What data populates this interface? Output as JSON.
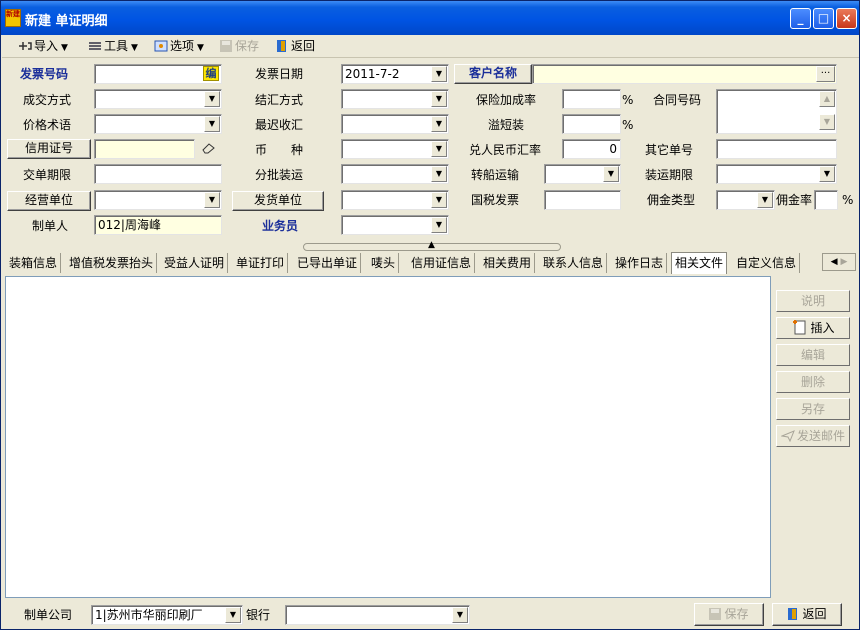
{
  "window": {
    "title": "新建 单证明细",
    "app_icon_text": "新建"
  },
  "title_buttons": {
    "minimize": "_",
    "maximize": "□",
    "close": "×"
  },
  "toolbar": {
    "import": "导入",
    "tools": "工具",
    "options": "选项",
    "save": "保存",
    "back": "返回"
  },
  "form": {
    "invoice_no_label": "发票号码",
    "invoice_no_badge": "编",
    "invoice_date_label": "发票日期",
    "invoice_date_value": "2011-7-2",
    "customer_name_button": "客户名称",
    "customer_name_ellipsis": "···",
    "deal_method_label": "成交方式",
    "settlement_method_label": "结汇方式",
    "insurance_markup_label": "保险加成率",
    "insurance_markup_unit": "%",
    "contract_no_label": "合同号码",
    "price_term_label": "价格术语",
    "latest_collection_label": "最迟收汇",
    "overage_label": "溢短装",
    "overage_unit": "%",
    "lc_no_button": "信用证号",
    "currency_label_1": "币",
    "currency_label_2": "种",
    "rmb_rate_label": "兑人民币汇率",
    "rmb_rate_value": "0",
    "other_doc_no_label": "其它单号",
    "delivery_period_label": "交单期限",
    "partial_shipment_label": "分批装运",
    "transshipment_label": "转船运输",
    "shipment_period_label": "装运期限",
    "business_unit_button": "经营单位",
    "shipper_button": "发货单位",
    "national_tax_invoice_label": "国税发票",
    "commission_type_label": "佣金类型",
    "commission_rate_label": "佣金率",
    "commission_rate_unit": "%",
    "maker_label": "制单人",
    "maker_value": "012|周海峰",
    "salesman_label": "业务员"
  },
  "tabs": [
    "装箱信息",
    "增值税发票抬头",
    "受益人证明",
    "单证打印",
    "已导出单证",
    "唛头",
    "信用证信息",
    "相关费用",
    "联系人信息",
    "操作日志",
    "相关文件",
    "自定义信息"
  ],
  "active_tab": "相关文件",
  "side_buttons": {
    "explain": "说明",
    "insert": "插入",
    "edit": "编辑",
    "delete": "删除",
    "save_as": "另存",
    "send_mail": "发送邮件"
  },
  "bottom": {
    "company_label": "制单公司",
    "company_value": "1|苏州市华丽印刷厂",
    "bank_label": "银行",
    "save": "保存",
    "back": "返回"
  },
  "colors": {
    "title_bar": "#0054e3",
    "window_bg": "#ece9d8",
    "label_blue": "#1b2f9a",
    "input_yellow": "#ffffe1"
  }
}
